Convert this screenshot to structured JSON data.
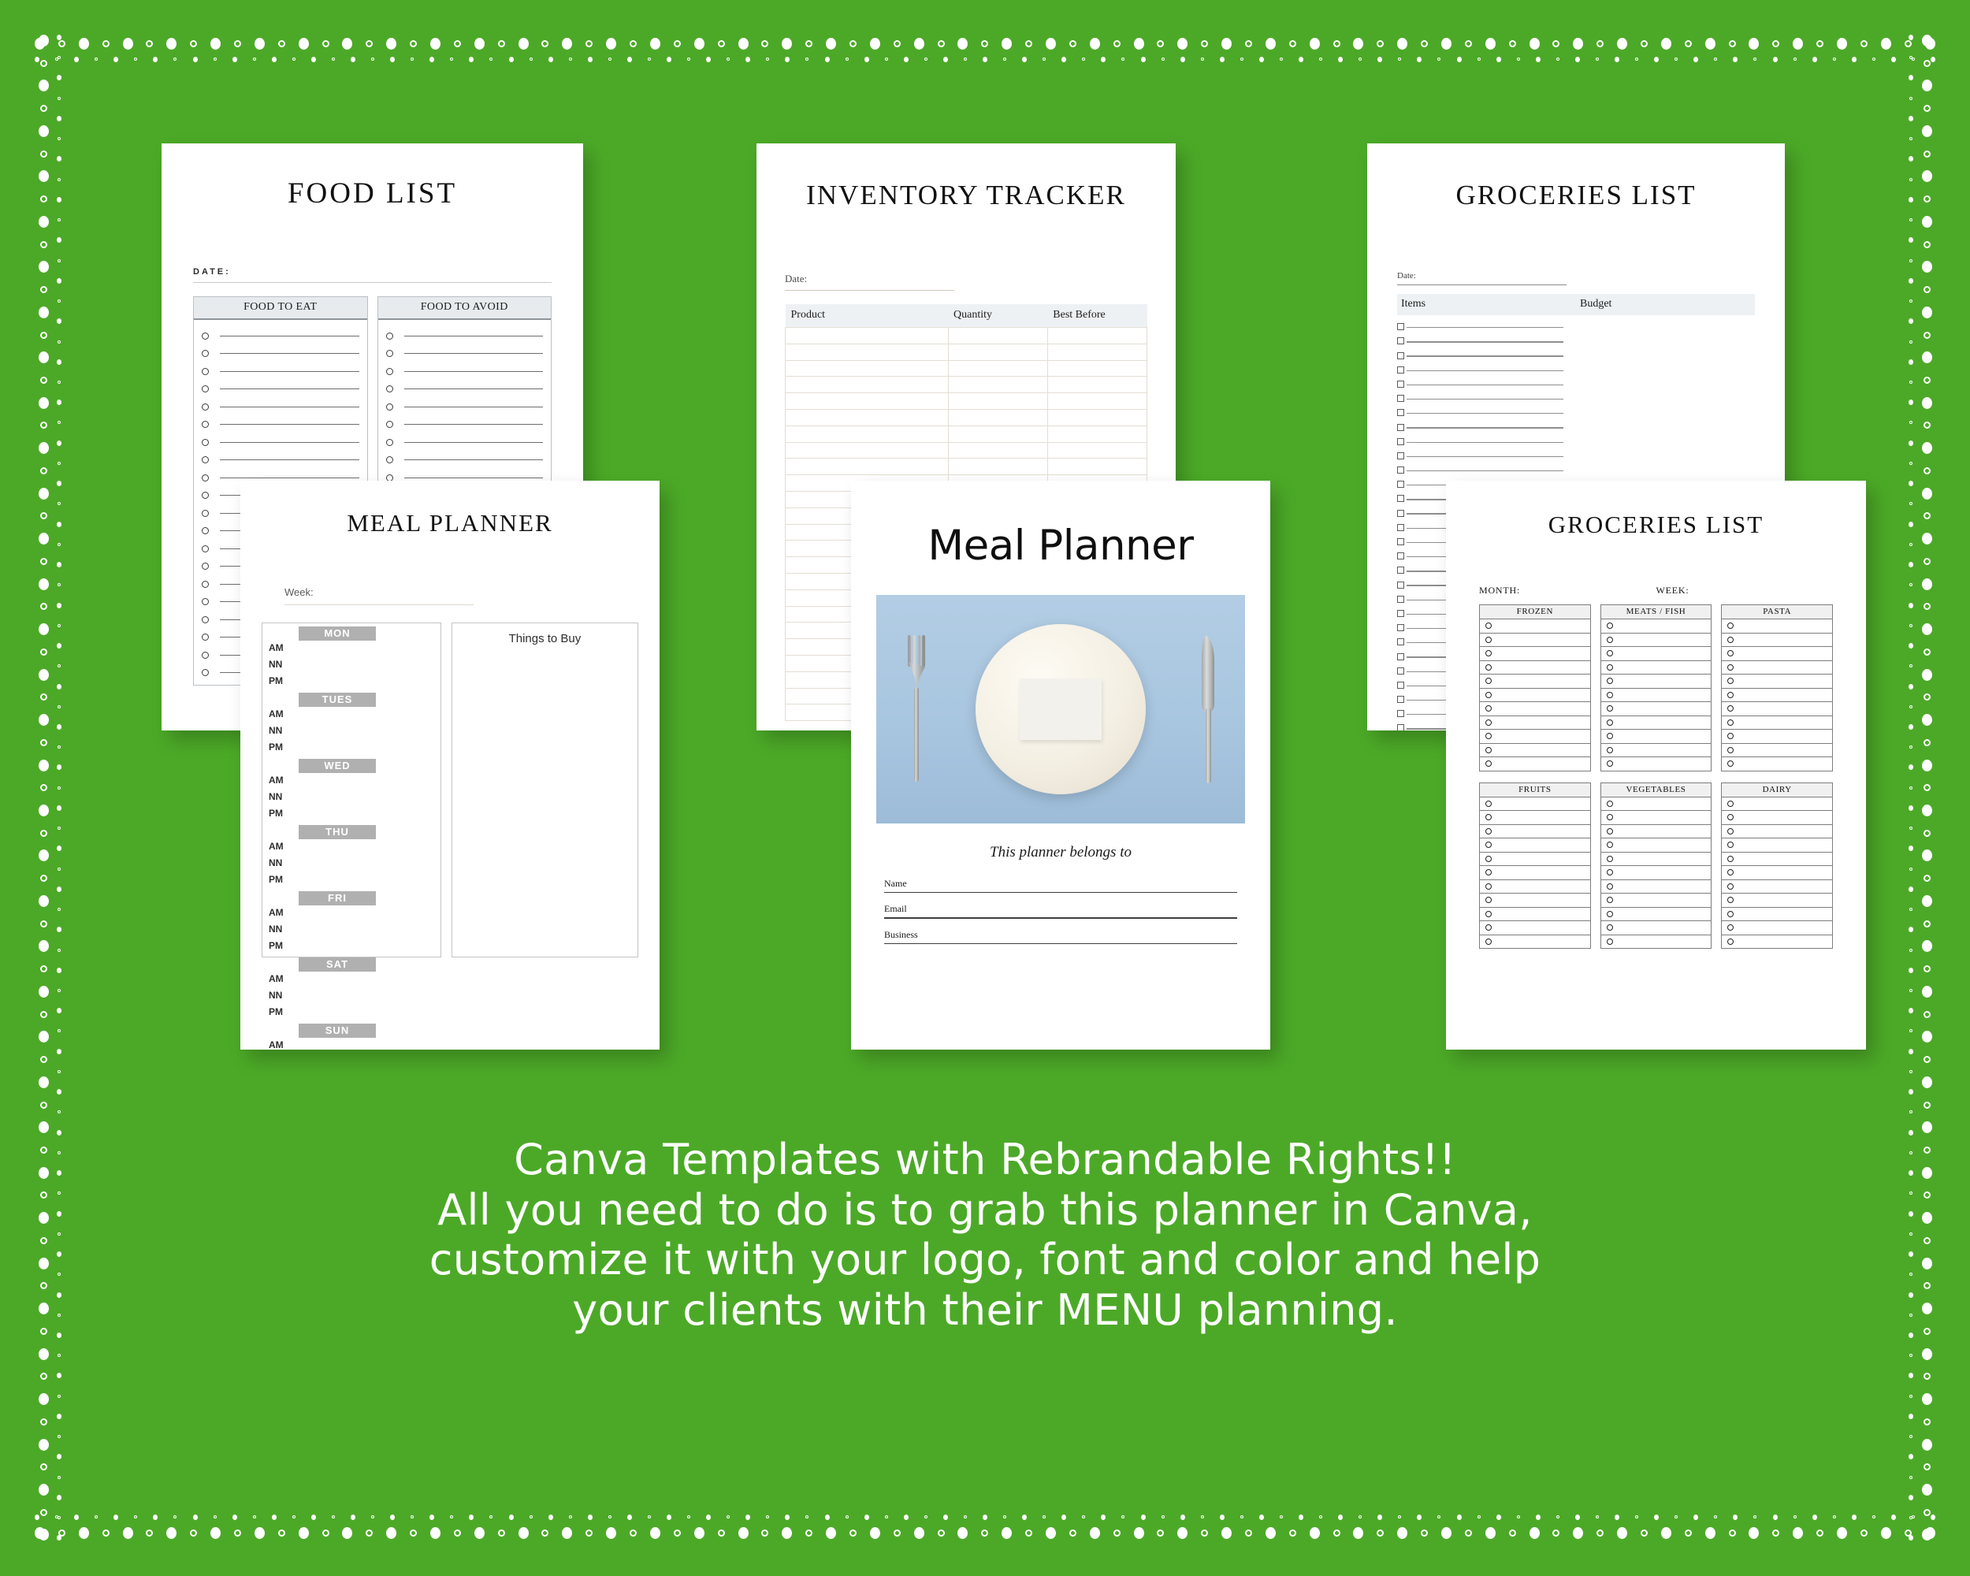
{
  "background_color": "#4CA927",
  "sheets": {
    "food_list": {
      "title": "FOOD LIST",
      "date_label": "DATE:",
      "columns": [
        "FOOD TO EAT",
        "FOOD TO AVOID"
      ],
      "row_count": 20
    },
    "inventory_tracker": {
      "title": "INVENTORY TRACKER",
      "date_label": "Date:",
      "columns": [
        "Product",
        "Quantity",
        "Best Before"
      ],
      "row_count": 24
    },
    "groceries_list_a": {
      "title": "GROCERIES LIST",
      "date_label": "Date:",
      "columns": [
        "Items",
        "Budget"
      ],
      "row_count": 30
    },
    "meal_planner_weekly": {
      "title": "MEAL PLANNER",
      "week_label": "Week:",
      "things_to_buy_label": "Things to Buy",
      "days": [
        "MON",
        "TUES",
        "WED",
        "THU",
        "FRI",
        "SAT",
        "SUN"
      ],
      "time_slots": [
        "AM",
        "NN",
        "PM"
      ]
    },
    "meal_planner_cover": {
      "title": "Meal Planner",
      "belongs_to": "This planner belongs to",
      "fields": [
        "Name",
        "Email",
        "Business"
      ],
      "photo_alt": "plate-with-fork-and-knife-on-blue-background"
    },
    "groceries_list_b": {
      "title": "GROCERIES LIST",
      "month_label": "MONTH:",
      "week_label": "WEEK:",
      "categories_row1": [
        "FROZEN",
        "MEATS / FISH",
        "PASTA"
      ],
      "categories_row2": [
        "FRUITS",
        "VEGETABLES",
        "DAIRY"
      ],
      "rows_per_category": 11
    }
  },
  "caption": {
    "line1": "Canva Templates with Rebrandable Rights!!",
    "line2": "All you need to do is to grab this planner in Canva,",
    "line3": "customize it with your logo, font and color and help",
    "line4": "your clients with their MENU planning."
  }
}
